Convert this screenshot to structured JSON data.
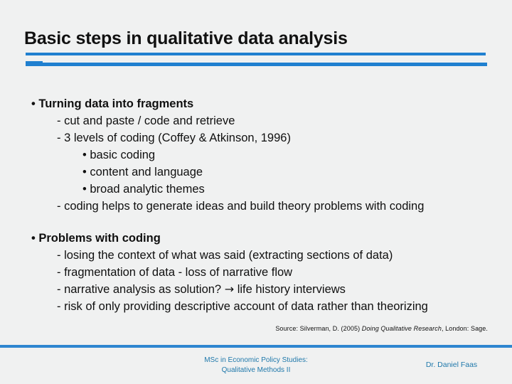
{
  "slide": {
    "title": "Basic steps in qualitative data analysis",
    "accent_color": "#2080d0",
    "footer_accent_color": "#2e86d0",
    "background_color": "#f0f1f1",
    "text_color": "#101010",
    "footer_text_color": "#2079ab"
  },
  "body": {
    "section1": {
      "heading": "• Turning data into fragments",
      "items": [
        "- cut and paste / code and retrieve",
        "- 3 levels of coding (Coffey & Atkinson, 1996)"
      ],
      "subitems": [
        "• basic coding",
        "• content and language",
        "• broad analytic themes"
      ],
      "closing": "- coding helps to generate ideas and build theory problems with coding"
    },
    "section2": {
      "heading": "• Problems with coding",
      "items": [
        "- losing the context of what was said (extracting sections of data)",
        "- fragmentation of data - loss of narrative flow"
      ],
      "item_arrow_prefix": "- narrative analysis as solution? ",
      "item_arrow_glyph": "→",
      "item_arrow_suffix": " life history interviews",
      "last_item": "- risk of only providing descriptive account of data rather than theorizing"
    }
  },
  "source": {
    "prefix": "Source: Silverman, D. (2005) ",
    "title_italic": "Doing Qualitative Research",
    "suffix": ", London: Sage."
  },
  "footer": {
    "center_line1": "MSc in Economic Policy Studies:",
    "center_line2": "Qualitative Methods II",
    "right": "Dr. Daniel Faas"
  }
}
